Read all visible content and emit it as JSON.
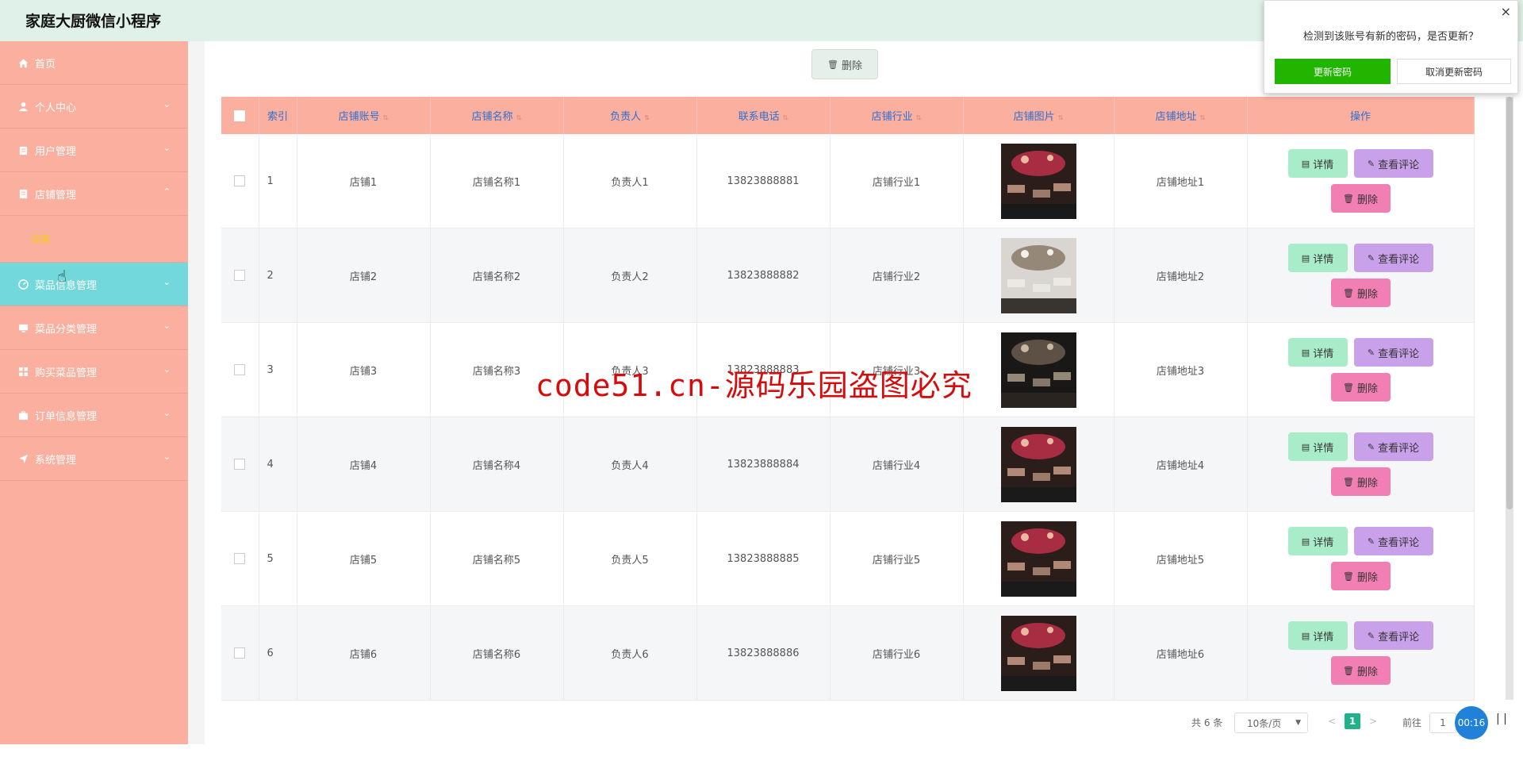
{
  "app": {
    "title": "家庭大厨微信小程序"
  },
  "sidebar": {
    "items": [
      {
        "label": "首页",
        "icon": "home-icon",
        "arrow": ""
      },
      {
        "label": "个人中心",
        "icon": "user-icon",
        "arrow": "⌄"
      },
      {
        "label": "用户管理",
        "icon": "clipboard-icon",
        "arrow": "⌄"
      },
      {
        "label": "店铺管理",
        "icon": "doc-icon",
        "arrow": "⌃"
      }
    ],
    "submenu": {
      "label": "店铺"
    },
    "items2": [
      {
        "label": "菜品信息管理",
        "icon": "gauge-icon",
        "arrow": "⌄",
        "active": true
      },
      {
        "label": "菜品分类管理",
        "icon": "monitor-icon",
        "arrow": "⌄"
      },
      {
        "label": "购买菜品管理",
        "icon": "grid-icon",
        "arrow": "⌄"
      },
      {
        "label": "订单信息管理",
        "icon": "briefcase-icon",
        "arrow": "⌄"
      },
      {
        "label": "系统管理",
        "icon": "send-icon",
        "arrow": "⌄"
      }
    ],
    "collapse_label": "|▷"
  },
  "toolbar": {
    "delete_label": "删除",
    "delete_icon": "🗑"
  },
  "table": {
    "headers": [
      "索引",
      "店铺账号",
      "店铺名称",
      "负责人",
      "联系电话",
      "店铺行业",
      "店铺图片",
      "店铺地址",
      "操作"
    ],
    "sort_icon": "⇅",
    "rows": [
      {
        "index": "1",
        "account": "店铺1",
        "name": "店铺名称1",
        "manager": "负责人1",
        "phone": "13823888881",
        "industry": "店铺行业1",
        "address": "店铺地址1",
        "img_tone": "a"
      },
      {
        "index": "2",
        "account": "店铺2",
        "name": "店铺名称2",
        "manager": "负责人2",
        "phone": "13823888882",
        "industry": "店铺行业2",
        "address": "店铺地址2",
        "img_tone": "b"
      },
      {
        "index": "3",
        "account": "店铺3",
        "name": "店铺名称3",
        "manager": "负责人3",
        "phone": "13823888883",
        "industry": "店铺行业3",
        "address": "店铺地址3",
        "img_tone": "c"
      },
      {
        "index": "4",
        "account": "店铺4",
        "name": "店铺名称4",
        "manager": "负责人4",
        "phone": "13823888884",
        "industry": "店铺行业4",
        "address": "店铺地址4",
        "img_tone": "a"
      },
      {
        "index": "5",
        "account": "店铺5",
        "name": "店铺名称5",
        "manager": "负责人5",
        "phone": "13823888885",
        "industry": "店铺行业5",
        "address": "店铺地址5",
        "img_tone": "a"
      },
      {
        "index": "6",
        "account": "店铺6",
        "name": "店铺名称6",
        "manager": "负责人6",
        "phone": "13823888886",
        "industry": "店铺行业6",
        "address": "店铺地址6",
        "img_tone": "a"
      }
    ],
    "actions": {
      "detail": "详情",
      "comment": "查看评论",
      "delete": "删除"
    }
  },
  "watermark": "code51.cn-源码乐园盗图必究",
  "pagination": {
    "total": "共 6 条",
    "page_size": "10条/页",
    "current_page": "1",
    "goto_label": "前往",
    "goto_value": "1",
    "prev": "<",
    "next": ">"
  },
  "timer": {
    "time": "00:16",
    "pause": "| |"
  },
  "popup": {
    "message": "检测到该账号有新的密码，是否更新？",
    "confirm": "更新密码",
    "cancel": "取消更新密码",
    "close": "×"
  },
  "colors": {
    "header_bg": "#dff1e8",
    "sidebar_bg": "#fbaf9f",
    "sidebar_active": "#72d8dc",
    "table_header_bg": "#fbaf9f",
    "detail_btn": "#a9ecc9",
    "comment_btn": "#c9a0ea",
    "delete_btn": "#f27fb3",
    "pager_active": "#20b38a",
    "popup_confirm": "#22b500",
    "watermark": "#d60b0b"
  }
}
